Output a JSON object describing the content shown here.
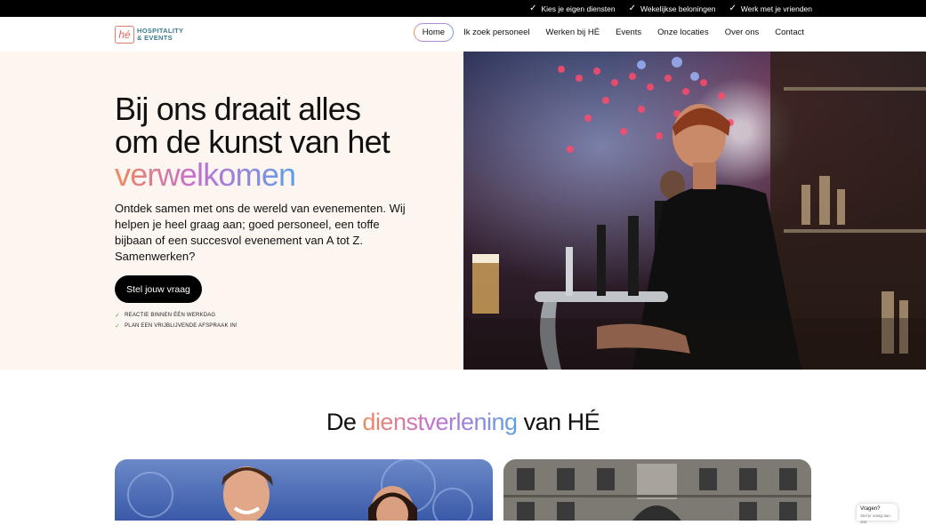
{
  "topbar": {
    "usps": [
      {
        "label": "Kies je eigen diensten",
        "icon": "check-icon"
      },
      {
        "label": "Wekelijkse beloningen",
        "icon": "check-icon"
      },
      {
        "label": "Werk met je vrienden",
        "icon": "check-icon"
      }
    ]
  },
  "header": {
    "logo": {
      "mark": "hé",
      "line1": "HOSPITALITY",
      "line2": "& EVENTS"
    },
    "nav": [
      {
        "label": "Home",
        "active": true
      },
      {
        "label": "Ik zoek personeel"
      },
      {
        "label": "Werken bij HÉ"
      },
      {
        "label": "Events"
      },
      {
        "label": "Onze locaties"
      },
      {
        "label": "Over ons"
      },
      {
        "label": "Contact"
      }
    ]
  },
  "hero": {
    "title_line1": "Bij ons draait alles",
    "title_line2": "om de kunst van het",
    "title_highlight": "verwelkomen",
    "subtitle": "Ontdek samen met ons de wereld van evenementen. Wij helpen je heel graag aan; goed personeel, een toffe bijbaan of een succesvol evenement van A tot Z. Samenwerken?",
    "cta": "Stel jouw vraag",
    "checks": [
      "REACTIE BINNEN ÉÉN WERKDAG",
      "PLAN EEN VRIJBLIJVENDE AFSPRAAK IN!"
    ]
  },
  "services": {
    "title_pre": "De",
    "title_highlight": "dienstverlening",
    "title_post": "van HÉ"
  },
  "chat": {
    "title": "Vragen?",
    "sub": "Stel je vraag aan ons"
  },
  "colors": {
    "accent_orange": "#f08a5d",
    "accent_purple": "#c46fd0",
    "accent_blue": "#5ea0e6",
    "hero_bg": "#fdf5f0"
  }
}
